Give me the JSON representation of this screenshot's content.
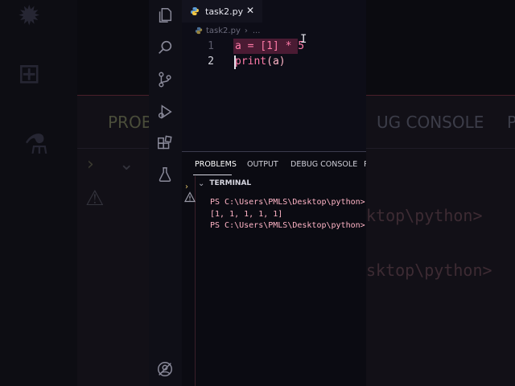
{
  "editor": {
    "tab": {
      "filename": "task2.py",
      "close_glyph": "✕"
    },
    "breadcrumb": {
      "filename": "task2.py",
      "more": "..."
    },
    "lines": [
      {
        "number": "1",
        "text": "a = [1] * 5"
      },
      {
        "number": "2",
        "text_fn": "print",
        "text_rest": "(a)"
      }
    ]
  },
  "panel": {
    "tabs": [
      "PROBLEMS",
      "OUTPUT",
      "DEBUG CONSOLE",
      "P"
    ],
    "active_tab": "PROBLEMS",
    "terminal_title": "TERMINAL",
    "terminal_lines": [
      "PS C:\\Users\\PMLS\\Desktop\\python>",
      "[1, 1, 1, 1, 1]",
      "PS C:\\Users\\PMLS\\Desktop\\python>"
    ]
  },
  "background": {
    "left_tab": "PROB",
    "right_tab": "UG CONSOLE",
    "edge_tab": "P",
    "term_fragment_1": "ktop\\python>",
    "term_fragment_2": "sktop\\python>"
  },
  "colors": {
    "accent": "#e06c9f",
    "selection": "#4a1b33",
    "terminal_text": "#ffb4c6",
    "keyword_var": "#ff7aa8",
    "background": "#0d0d17"
  },
  "icons": {
    "activity": [
      "explorer-icon",
      "search-icon",
      "source-control-icon",
      "run-debug-icon",
      "extensions-icon",
      "testing-icon",
      "accounts-icon"
    ]
  }
}
